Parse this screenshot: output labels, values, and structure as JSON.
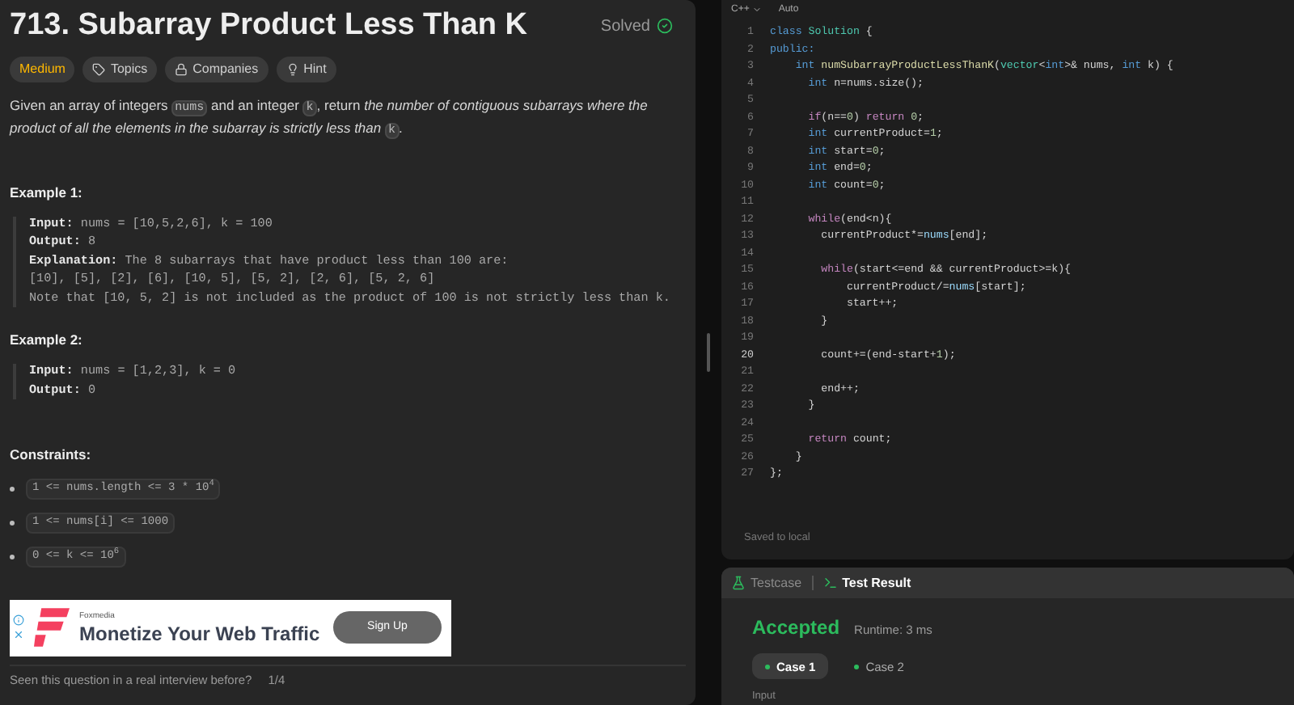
{
  "problem": {
    "title": "713. Subarray Product Less Than K",
    "status": "Solved",
    "solved": true,
    "tags": [
      {
        "kind": "difficulty",
        "label": "Medium"
      },
      {
        "kind": "topics",
        "label": "Topics"
      },
      {
        "kind": "companies",
        "label": "Companies"
      },
      {
        "kind": "hint",
        "label": "Hint"
      }
    ],
    "description": [
      {
        "kind": "text",
        "text": "Given an array of integers "
      },
      {
        "kind": "code",
        "text": "nums"
      },
      {
        "kind": "text",
        "text": " and an integer "
      },
      {
        "kind": "code",
        "text": "k"
      },
      {
        "kind": "text",
        "text": ", return "
      },
      {
        "kind": "italic",
        "text": "the number of contiguous subarrays where the product of all the elements in the subarray is strictly less than "
      },
      {
        "kind": "code",
        "text": "k"
      },
      {
        "kind": "text",
        "text": "."
      }
    ],
    "examples": [
      {
        "heading": "Example 1:",
        "lines": [
          {
            "label": "Input:",
            "value": "nums = [10,5,2,6], k = 100"
          },
          {
            "label": "Output:",
            "value": "8"
          },
          {
            "label": "Explanation:",
            "value": "The 8 subarrays that have product less than 100 are:"
          },
          {
            "value": "[10], [5], [2], [6], [10, 5], [5, 2], [2, 6], [5, 2, 6]"
          },
          {
            "value": "Note that [10, 5, 2] is not included as the product of 100 is not strictly less than k."
          }
        ]
      },
      {
        "heading": "Example 2:",
        "lines": [
          {
            "label": "Input:",
            "value": "nums = [1,2,3], k = 0"
          },
          {
            "label": "Output:",
            "value": "0"
          }
        ]
      }
    ],
    "constraints_heading": "Constraints:",
    "constraints": [
      "1 <= nums.length <= 3 * 10$^{4}$",
      "1 <= nums[i] <= 1000",
      "0 <= k <= 10$^{6}$"
    ],
    "ad": {
      "brand": "Foxmedia",
      "headline": "Monetize Your Web Traffic",
      "button": "Sign Up"
    },
    "footer": {
      "question": "Seen this question in a real interview before?",
      "page": "1/4"
    }
  },
  "editor": {
    "language": "C++",
    "mode": "Auto",
    "saved": "Saved to local",
    "lines": [
      {
        "number": "1",
        "active": false,
        "tokens": [
          {
            "kind": "keyword",
            "text": "class "
          },
          {
            "kind": "type",
            "text": "Solution"
          },
          {
            "kind": "plain",
            "text": " {"
          }
        ]
      },
      {
        "number": "2",
        "active": false,
        "tokens": [
          {
            "kind": "keyword",
            "text": "public:"
          }
        ]
      },
      {
        "number": "3",
        "active": false,
        "tokens": [
          {
            "kind": "keyword",
            "text": "    int "
          },
          {
            "kind": "function",
            "text": "numSubarrayProductLessThanK"
          },
          {
            "kind": "plain",
            "text": "("
          },
          {
            "kind": "type",
            "text": "vector"
          },
          {
            "kind": "plain",
            "text": "<"
          },
          {
            "kind": "keyword",
            "text": "int"
          },
          {
            "kind": "plain",
            "text": ">& nums, "
          },
          {
            "kind": "keyword",
            "text": "int"
          },
          {
            "kind": "plain",
            "text": " k) {"
          }
        ]
      },
      {
        "number": "4",
        "active": false,
        "tokens": [
          {
            "kind": "keyword",
            "text": "      int "
          },
          {
            "kind": "plain",
            "text": "n=nums.size();"
          }
        ]
      },
      {
        "number": "5",
        "active": false
      },
      {
        "number": "6",
        "active": false,
        "tokens": [
          {
            "kind": "control",
            "text": "      if"
          },
          {
            "kind": "plain",
            "text": "(n=="
          },
          {
            "kind": "number",
            "text": "0"
          },
          {
            "kind": "plain",
            "text": ") "
          },
          {
            "kind": "control",
            "text": "return "
          },
          {
            "kind": "number",
            "text": "0"
          },
          {
            "kind": "plain",
            "text": ";"
          }
        ]
      },
      {
        "number": "7",
        "active": false,
        "tokens": [
          {
            "kind": "keyword",
            "text": "      int "
          },
          {
            "kind": "plain",
            "text": "currentProduct="
          },
          {
            "kind": "number",
            "text": "1"
          },
          {
            "kind": "plain",
            "text": ";"
          }
        ]
      },
      {
        "number": "8",
        "active": false,
        "tokens": [
          {
            "kind": "keyword",
            "text": "      int "
          },
          {
            "kind": "plain",
            "text": "start="
          },
          {
            "kind": "number",
            "text": "0"
          },
          {
            "kind": "plain",
            "text": ";"
          }
        ]
      },
      {
        "number": "9",
        "active": false,
        "tokens": [
          {
            "kind": "keyword",
            "text": "      int "
          },
          {
            "kind": "plain",
            "text": "end="
          },
          {
            "kind": "number",
            "text": "0"
          },
          {
            "kind": "plain",
            "text": ";"
          }
        ]
      },
      {
        "number": "10",
        "active": false,
        "tokens": [
          {
            "kind": "keyword",
            "text": "      int "
          },
          {
            "kind": "plain",
            "text": "count="
          },
          {
            "kind": "number",
            "text": "0"
          },
          {
            "kind": "plain",
            "text": ";"
          }
        ]
      },
      {
        "number": "11",
        "active": false
      },
      {
        "number": "12",
        "active": false,
        "tokens": [
          {
            "kind": "control",
            "text": "      while"
          },
          {
            "kind": "plain",
            "text": "(end<n){"
          }
        ]
      },
      {
        "number": "13",
        "active": false,
        "tokens": [
          {
            "kind": "plain",
            "text": "        currentProduct*="
          },
          {
            "kind": "variable",
            "text": "nums"
          },
          {
            "kind": "plain",
            "text": "[end];"
          }
        ]
      },
      {
        "number": "14",
        "active": false
      },
      {
        "number": "15",
        "active": false,
        "tokens": [
          {
            "kind": "control",
            "text": "        while"
          },
          {
            "kind": "plain",
            "text": "(start<=end && currentProduct>=k){"
          }
        ]
      },
      {
        "number": "16",
        "active": false,
        "tokens": [
          {
            "kind": "plain",
            "text": "            currentProduct/="
          },
          {
            "kind": "variable",
            "text": "nums"
          },
          {
            "kind": "plain",
            "text": "[start];"
          }
        ]
      },
      {
        "number": "17",
        "active": false,
        "tokens": [
          {
            "kind": "plain",
            "text": "            start++;"
          }
        ]
      },
      {
        "number": "18",
        "active": false,
        "tokens": [
          {
            "kind": "plain",
            "text": "        }"
          }
        ]
      },
      {
        "number": "19",
        "active": false
      },
      {
        "number": "20",
        "active": true,
        "tokens": [
          {
            "kind": "plain",
            "text": "        count+=(end-start+"
          },
          {
            "kind": "number",
            "text": "1"
          },
          {
            "kind": "plain",
            "text": ");"
          }
        ]
      },
      {
        "number": "21",
        "active": false
      },
      {
        "number": "22",
        "active": false,
        "tokens": [
          {
            "kind": "plain",
            "text": "        end++;"
          }
        ]
      },
      {
        "number": "23",
        "active": false,
        "tokens": [
          {
            "kind": "plain",
            "text": "      }"
          }
        ]
      },
      {
        "number": "24",
        "active": false
      },
      {
        "number": "25",
        "active": false,
        "tokens": [
          {
            "kind": "control",
            "text": "      return "
          },
          {
            "kind": "plain",
            "text": "count;"
          }
        ]
      },
      {
        "number": "26",
        "active": false,
        "tokens": [
          {
            "kind": "plain",
            "text": "    }"
          }
        ]
      },
      {
        "number": "27",
        "active": false,
        "tokens": [
          {
            "kind": "plain",
            "text": "};"
          }
        ]
      }
    ]
  },
  "results": {
    "tabs": [
      {
        "kind": "testcase",
        "label": "Testcase",
        "selected": false
      },
      {
        "kind": "result",
        "label": "Test Result",
        "selected": true
      }
    ],
    "verdict": "Accepted",
    "accepted": true,
    "runtime": "Runtime: 3 ms",
    "cases": [
      {
        "label": "Case 1",
        "selected": true,
        "passed": true
      },
      {
        "label": "Case 2",
        "selected": false,
        "passed": true
      }
    ],
    "input_label": "Input"
  }
}
